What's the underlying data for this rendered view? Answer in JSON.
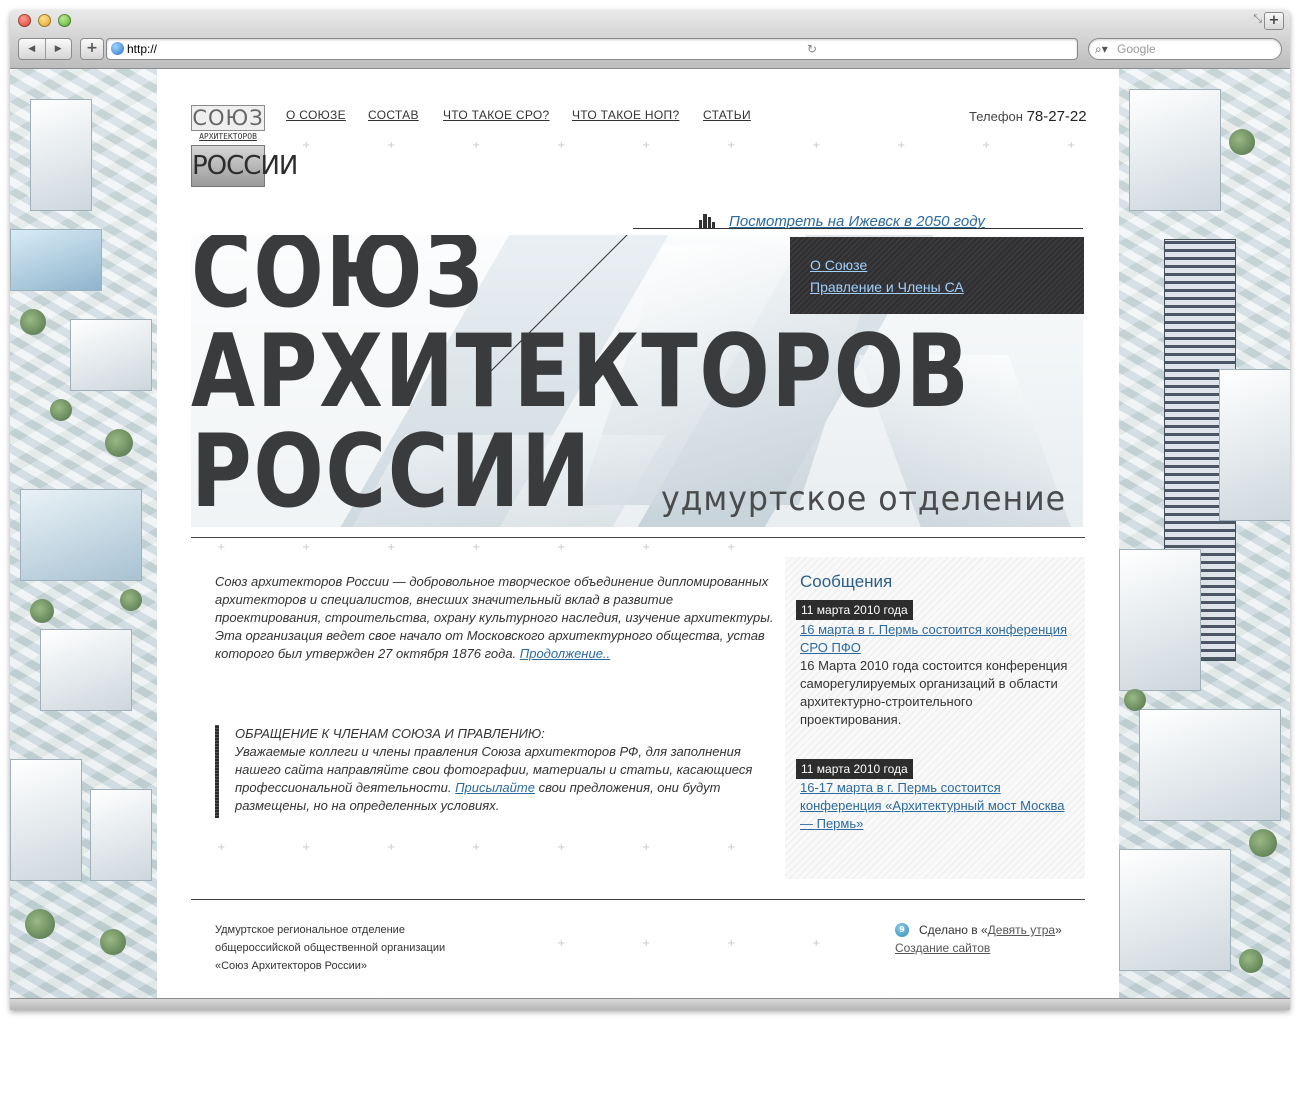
{
  "browser": {
    "url": "http://",
    "search_placeholder": "Google",
    "back_label": "◀",
    "forward_label": "▶",
    "add_label": "+",
    "reload_label": "↻",
    "new_tab_label": "+"
  },
  "header": {
    "logo": {
      "line1": "СОЮЗ",
      "line2": "АРХИТЕКТОРОВ",
      "line3": "РОССИИ"
    },
    "nav": [
      {
        "label": "О СОЮЗЕ"
      },
      {
        "label": "СОСТАВ"
      },
      {
        "label": "ЧТО ТАКОЕ СРО?"
      },
      {
        "label": "ЧТО ТАКОЕ НОП?"
      },
      {
        "label": "СТАТЬИ"
      }
    ],
    "phone_label": "Телефон",
    "phone_number": "78-27-22"
  },
  "future_link": "Посмотреть на Ижевск в 2050 году",
  "hero": {
    "title_line1": "СОЮЗ",
    "title_line2": "АРХИТЕКТОРОВ",
    "title_line3": "РОССИИ",
    "subtitle": "удмуртское отделение",
    "menu": [
      {
        "label": "О Союзе"
      },
      {
        "label": "Правление и Члены СА"
      }
    ]
  },
  "intro": {
    "text": "Союз архитекторов России — добровольное творческое объединение дипломированных архитекторов и специалистов, внесших значительный вклад в развитие проектирования, строительства, охрану культурного наследия, изучение архитектуры. Эта организация ведет свое начало от Московского архитектурного общества, устав которого был утвержден 27 октября 1876 года.",
    "more_link": "Продолжение.."
  },
  "appeal": {
    "heading": "ОБРАЩЕНИЕ К ЧЛЕНАМ СОЮЗА И ПРАВЛЕНИЮ:",
    "text_before": "Уважаемые коллеги и члены правления Союза архитекторов РФ, для заполнения нашего сайта направляйте свои фотографии, материалы и статьи, касающиеся профессиональной деятельности.",
    "link": "Присылайте",
    "text_after": "свои предложения, они будут размещены, но на определенных условиях."
  },
  "news": {
    "title": "Сообщения",
    "items": [
      {
        "date": "11 марта 2010 года",
        "headline": "16 марта в г. Пермь состоится конференция СРО ПФО",
        "body": "16 Марта 2010 года состоится конференция саморегулируемых организаций в области архитектурно-строительного проектирования."
      },
      {
        "date": "11 марта 2010 года",
        "headline": "16-17 марта в г. Пермь состоится конференция «Архитектурный мост Москва — Пермь»",
        "body": ""
      }
    ]
  },
  "footer": {
    "org_line1": "Удмуртское региональное отделение",
    "org_line2": "общероссийской общественной организации",
    "org_line3": "«Союз Архитекторов России»",
    "badge": "9",
    "made_prefix": "Сделано в «",
    "made_link": "Девять утра",
    "made_suffix": "»",
    "sites_link": "Создание сайтов"
  },
  "colors": {
    "link": "#2b6aa0",
    "dark_panel": "#2f2f31",
    "hero_text": "#3a3b3d",
    "news_title": "#2a5f8a"
  }
}
